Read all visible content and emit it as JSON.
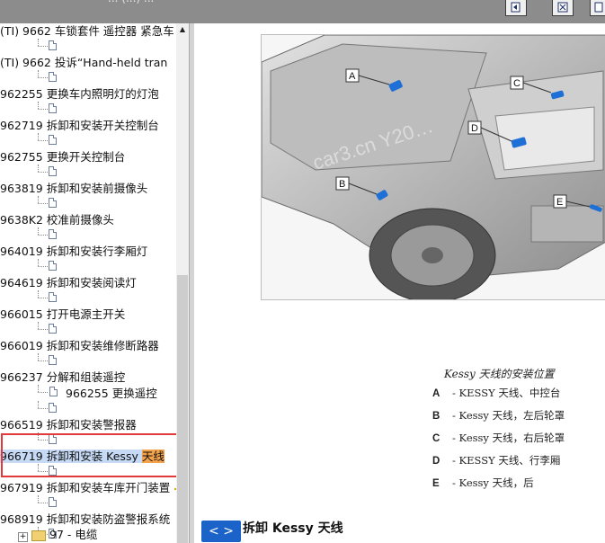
{
  "window": {
    "title": "... (...) ..."
  },
  "tree": {
    "items": [
      {
        "code": "(TI) 9662",
        "text": "车锁套件 遥控器 紧急车"
      },
      {
        "code": "(TI) 9662",
        "text": "投诉“Hand-held tran"
      },
      {
        "code": "962255",
        "text": "更换车内照明灯的灯泡"
      },
      {
        "code": "962719",
        "text": "拆卸和安装开关控制台"
      },
      {
        "code": "962755",
        "text": "更换开关控制台"
      },
      {
        "code": "963819",
        "text": "拆卸和安装前摄像头"
      },
      {
        "code": "9638K2",
        "text": "校准前摄像头"
      },
      {
        "code": "964019",
        "text": "拆卸和安装行李厢灯"
      },
      {
        "code": "964619",
        "text": "拆卸和安装阅读灯"
      },
      {
        "code": "966015",
        "text": "打开电源主开关"
      },
      {
        "code": "966019",
        "text": "拆卸和安装维修断路器"
      },
      {
        "code": "966237",
        "text": "分解和组装遥控"
      },
      {
        "code": "966255",
        "text": "更换遥控"
      },
      {
        "code": "966519",
        "text": "拆卸和安装警报器"
      },
      {
        "code": "966719",
        "text": "拆卸和安装 Kessy",
        "highlight": "天线"
      },
      {
        "code": "967919",
        "text": "拆卸和安装车库开门装置"
      },
      {
        "code": "968919",
        "text": "拆卸和安装防盗警报系统"
      }
    ],
    "folder": "97 - 电缆"
  },
  "figure": {
    "labels": [
      "A",
      "B",
      "C",
      "D",
      "E"
    ],
    "watermark": "car3.cn Y20…"
  },
  "legend": {
    "title": "Kessy 天线的安装位置",
    "rows": [
      {
        "key": "A",
        "text": "- KESSY 天线、中控台"
      },
      {
        "key": "B",
        "text": "- Kessy 天线，左后轮罩"
      },
      {
        "key": "C",
        "text": "- Kessy 天线，右后轮罩"
      },
      {
        "key": "D",
        "text": "- KESSY 天线、行李厢"
      },
      {
        "key": "E",
        "text": "- Kessy 天线，后"
      }
    ]
  },
  "nav": {
    "label": "< >"
  },
  "section_heading": "拆卸  Kessy 天线",
  "colors": {
    "accent": "#1b63c8",
    "selection": "#c6d9f5",
    "search_highlight": "#f5a34a",
    "annotation": "#e23a3a"
  }
}
